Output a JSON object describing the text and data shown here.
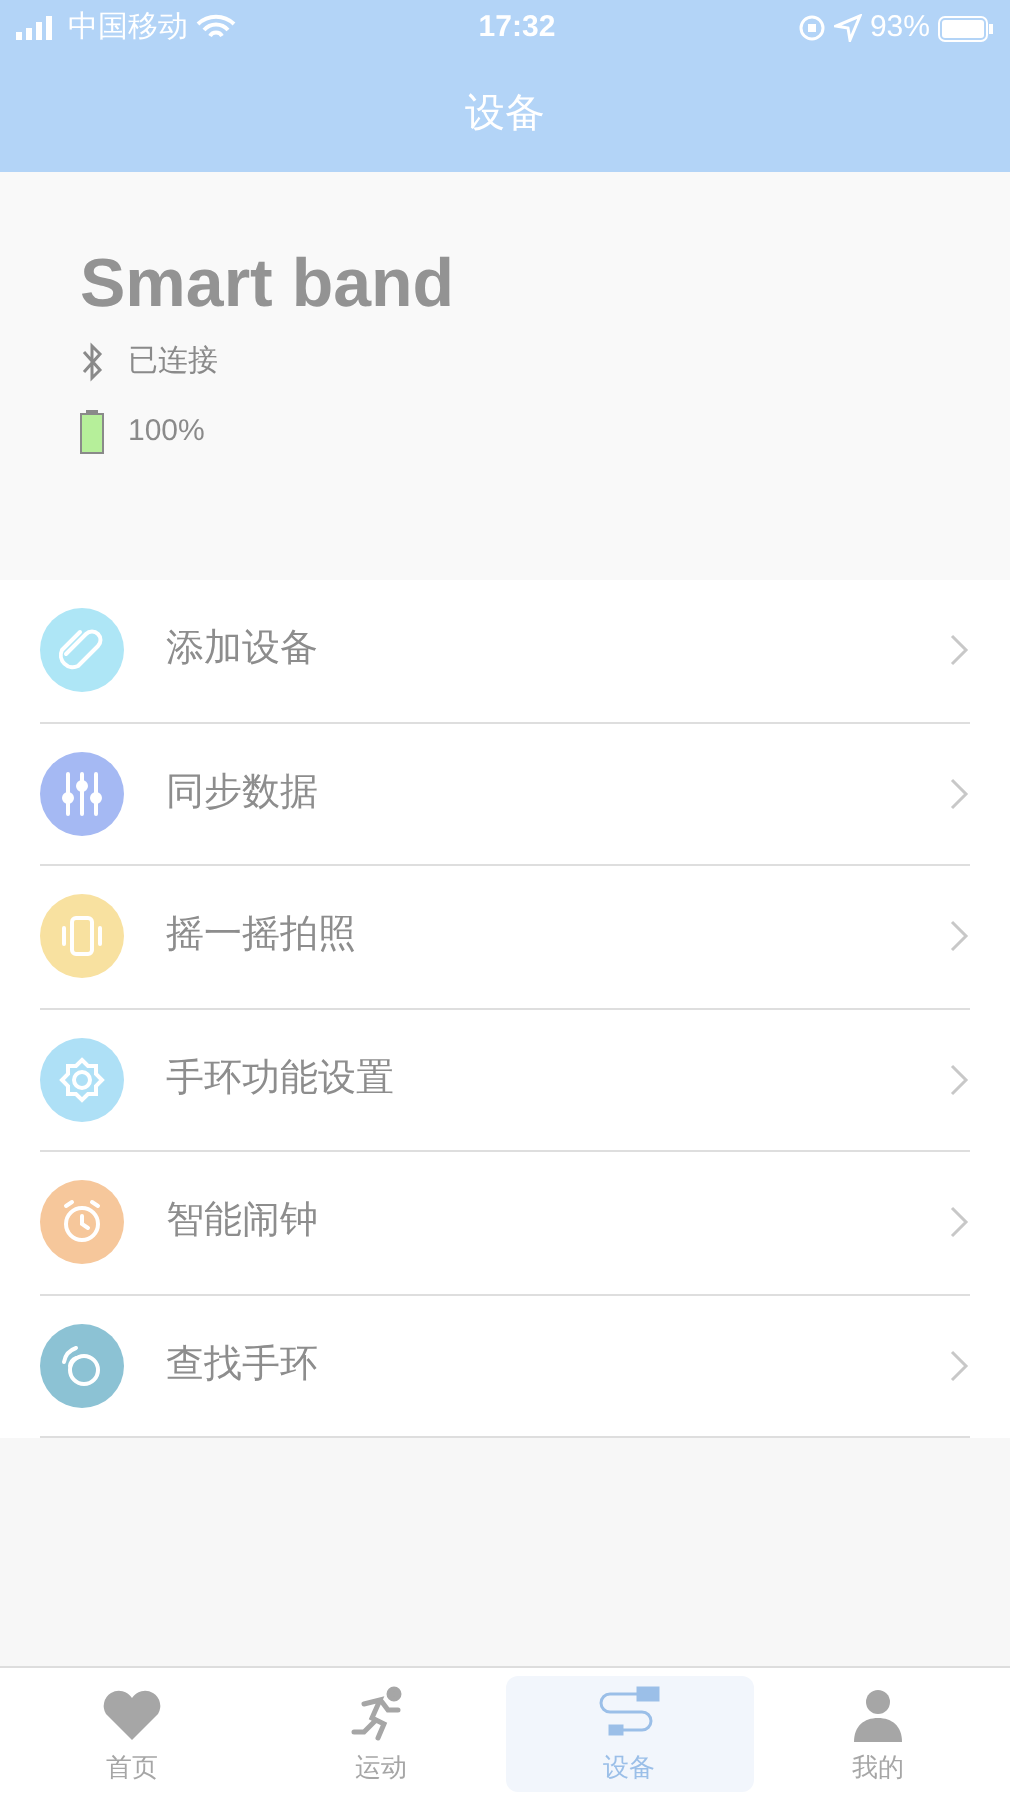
{
  "status_bar": {
    "carrier": "中国移动",
    "time": "17:32",
    "battery": "93%"
  },
  "nav_bar": {
    "title": "设备"
  },
  "device": {
    "name": "Smart band",
    "connection": "已连接",
    "battery": "100%"
  },
  "menu": [
    {
      "label": "添加设备",
      "color": "#aee6f6"
    },
    {
      "label": "同步数据",
      "color": "#a5b9f3"
    },
    {
      "label": "摇一摇拍照",
      "color": "#f8e1a0"
    },
    {
      "label": "手环功能设置",
      "color": "#aee0f6"
    },
    {
      "label": "智能闹钟",
      "color": "#f6c79b"
    },
    {
      "label": "查找手环",
      "color": "#8cc2d4"
    }
  ],
  "tab_bar": [
    {
      "label": "首页",
      "selected": false
    },
    {
      "label": "运动",
      "selected": false
    },
    {
      "label": "设备",
      "selected": true
    },
    {
      "label": "我的",
      "selected": false
    }
  ]
}
